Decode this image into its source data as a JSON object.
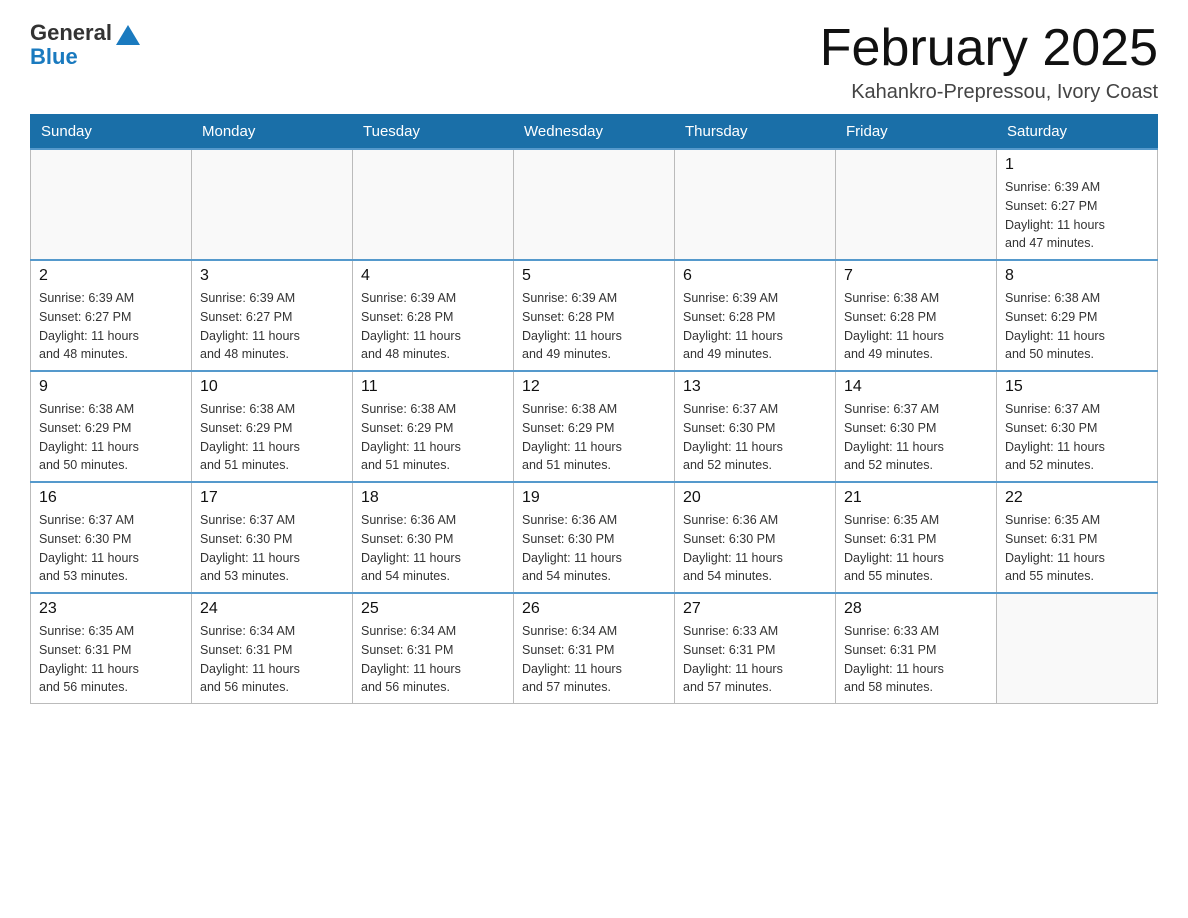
{
  "header": {
    "logo_text_general": "General",
    "logo_text_blue": "Blue",
    "month_title": "February 2025",
    "location": "Kahankro-Prepressou, Ivory Coast"
  },
  "days_of_week": [
    "Sunday",
    "Monday",
    "Tuesday",
    "Wednesday",
    "Thursday",
    "Friday",
    "Saturday"
  ],
  "weeks": [
    {
      "days": [
        {
          "num": "",
          "info": ""
        },
        {
          "num": "",
          "info": ""
        },
        {
          "num": "",
          "info": ""
        },
        {
          "num": "",
          "info": ""
        },
        {
          "num": "",
          "info": ""
        },
        {
          "num": "",
          "info": ""
        },
        {
          "num": "1",
          "info": "Sunrise: 6:39 AM\nSunset: 6:27 PM\nDaylight: 11 hours\nand 47 minutes."
        }
      ]
    },
    {
      "days": [
        {
          "num": "2",
          "info": "Sunrise: 6:39 AM\nSunset: 6:27 PM\nDaylight: 11 hours\nand 48 minutes."
        },
        {
          "num": "3",
          "info": "Sunrise: 6:39 AM\nSunset: 6:27 PM\nDaylight: 11 hours\nand 48 minutes."
        },
        {
          "num": "4",
          "info": "Sunrise: 6:39 AM\nSunset: 6:28 PM\nDaylight: 11 hours\nand 48 minutes."
        },
        {
          "num": "5",
          "info": "Sunrise: 6:39 AM\nSunset: 6:28 PM\nDaylight: 11 hours\nand 49 minutes."
        },
        {
          "num": "6",
          "info": "Sunrise: 6:39 AM\nSunset: 6:28 PM\nDaylight: 11 hours\nand 49 minutes."
        },
        {
          "num": "7",
          "info": "Sunrise: 6:38 AM\nSunset: 6:28 PM\nDaylight: 11 hours\nand 49 minutes."
        },
        {
          "num": "8",
          "info": "Sunrise: 6:38 AM\nSunset: 6:29 PM\nDaylight: 11 hours\nand 50 minutes."
        }
      ]
    },
    {
      "days": [
        {
          "num": "9",
          "info": "Sunrise: 6:38 AM\nSunset: 6:29 PM\nDaylight: 11 hours\nand 50 minutes."
        },
        {
          "num": "10",
          "info": "Sunrise: 6:38 AM\nSunset: 6:29 PM\nDaylight: 11 hours\nand 51 minutes."
        },
        {
          "num": "11",
          "info": "Sunrise: 6:38 AM\nSunset: 6:29 PM\nDaylight: 11 hours\nand 51 minutes."
        },
        {
          "num": "12",
          "info": "Sunrise: 6:38 AM\nSunset: 6:29 PM\nDaylight: 11 hours\nand 51 minutes."
        },
        {
          "num": "13",
          "info": "Sunrise: 6:37 AM\nSunset: 6:30 PM\nDaylight: 11 hours\nand 52 minutes."
        },
        {
          "num": "14",
          "info": "Sunrise: 6:37 AM\nSunset: 6:30 PM\nDaylight: 11 hours\nand 52 minutes."
        },
        {
          "num": "15",
          "info": "Sunrise: 6:37 AM\nSunset: 6:30 PM\nDaylight: 11 hours\nand 52 minutes."
        }
      ]
    },
    {
      "days": [
        {
          "num": "16",
          "info": "Sunrise: 6:37 AM\nSunset: 6:30 PM\nDaylight: 11 hours\nand 53 minutes."
        },
        {
          "num": "17",
          "info": "Sunrise: 6:37 AM\nSunset: 6:30 PM\nDaylight: 11 hours\nand 53 minutes."
        },
        {
          "num": "18",
          "info": "Sunrise: 6:36 AM\nSunset: 6:30 PM\nDaylight: 11 hours\nand 54 minutes."
        },
        {
          "num": "19",
          "info": "Sunrise: 6:36 AM\nSunset: 6:30 PM\nDaylight: 11 hours\nand 54 minutes."
        },
        {
          "num": "20",
          "info": "Sunrise: 6:36 AM\nSunset: 6:30 PM\nDaylight: 11 hours\nand 54 minutes."
        },
        {
          "num": "21",
          "info": "Sunrise: 6:35 AM\nSunset: 6:31 PM\nDaylight: 11 hours\nand 55 minutes."
        },
        {
          "num": "22",
          "info": "Sunrise: 6:35 AM\nSunset: 6:31 PM\nDaylight: 11 hours\nand 55 minutes."
        }
      ]
    },
    {
      "days": [
        {
          "num": "23",
          "info": "Sunrise: 6:35 AM\nSunset: 6:31 PM\nDaylight: 11 hours\nand 56 minutes."
        },
        {
          "num": "24",
          "info": "Sunrise: 6:34 AM\nSunset: 6:31 PM\nDaylight: 11 hours\nand 56 minutes."
        },
        {
          "num": "25",
          "info": "Sunrise: 6:34 AM\nSunset: 6:31 PM\nDaylight: 11 hours\nand 56 minutes."
        },
        {
          "num": "26",
          "info": "Sunrise: 6:34 AM\nSunset: 6:31 PM\nDaylight: 11 hours\nand 57 minutes."
        },
        {
          "num": "27",
          "info": "Sunrise: 6:33 AM\nSunset: 6:31 PM\nDaylight: 11 hours\nand 57 minutes."
        },
        {
          "num": "28",
          "info": "Sunrise: 6:33 AM\nSunset: 6:31 PM\nDaylight: 11 hours\nand 58 minutes."
        },
        {
          "num": "",
          "info": ""
        }
      ]
    }
  ]
}
